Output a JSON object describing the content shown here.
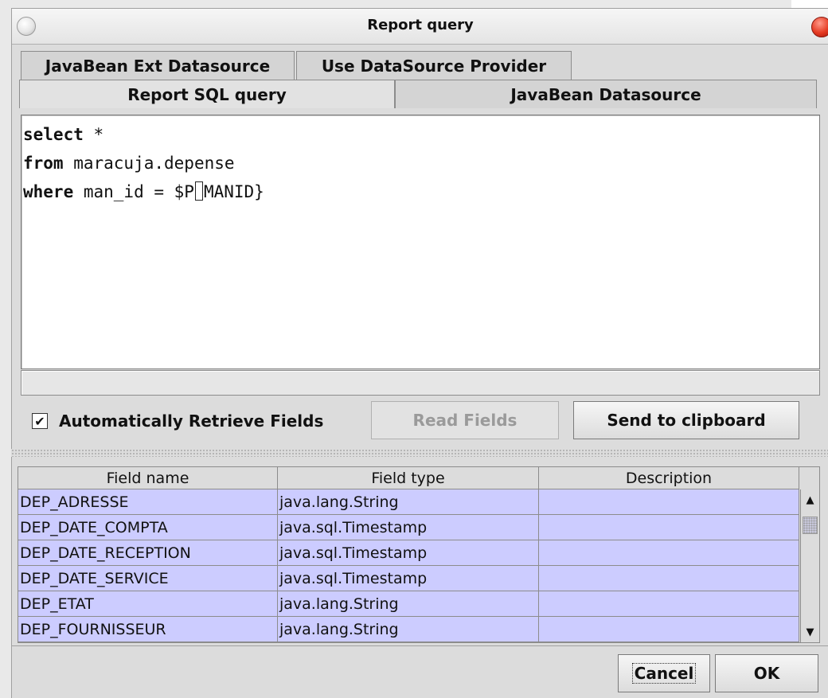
{
  "window": {
    "title": "Report query"
  },
  "tabs": {
    "row1": [
      {
        "label": "JavaBean Ext Datasource"
      },
      {
        "label": "Use DataSource Provider"
      }
    ],
    "row2": [
      {
        "label": "Report SQL query"
      },
      {
        "label": "JavaBean Datasource"
      }
    ]
  },
  "editor": {
    "lines": [
      {
        "keyword": "select",
        "rest": " *",
        "caret_before": "",
        "caret_after": ""
      },
      {
        "keyword": "from",
        "rest": " maracuja.depense",
        "caret_before": "",
        "caret_after": ""
      },
      {
        "keyword": "where",
        "rest": "",
        "caret_before": " man_id = $P",
        "caret_after": "MANID}"
      }
    ]
  },
  "controls": {
    "auto_retrieve_checked_mark": "✔",
    "auto_retrieve_label": "Automatically Retrieve Fields",
    "read_fields_label": "Read Fields",
    "send_clipboard_label": "Send to clipboard"
  },
  "fields_table": {
    "columns": [
      "Field name",
      "Field type",
      "Description"
    ],
    "rows": [
      [
        "DEP_ADRESSE",
        "java.lang.String",
        ""
      ],
      [
        "DEP_DATE_COMPTA",
        "java.sql.Timestamp",
        ""
      ],
      [
        "DEP_DATE_RECEPTION",
        "java.sql.Timestamp",
        ""
      ],
      [
        "DEP_DATE_SERVICE",
        "java.sql.Timestamp",
        ""
      ],
      [
        "DEP_ETAT",
        "java.lang.String",
        ""
      ],
      [
        "DEP_FOURNISSEUR",
        "java.lang.String",
        ""
      ]
    ]
  },
  "footer": {
    "cancel_label": "Cancel",
    "ok_label": "OK"
  },
  "colors": {
    "row_highlight": "#ccccff",
    "close_button": "#e53a22"
  }
}
